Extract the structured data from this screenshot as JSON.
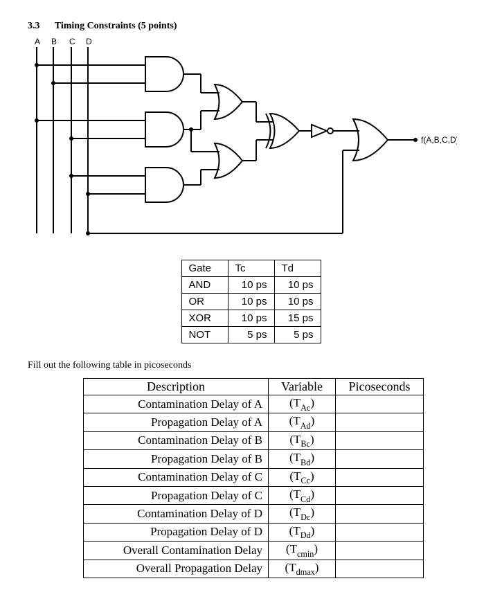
{
  "heading": {
    "section_number": "3.3",
    "title": "Timing Constraints (5 points)"
  },
  "inputs": [
    "A",
    "B",
    "C",
    "D"
  ],
  "output_label": "f(A,B,C,D)",
  "gate_timing": {
    "headers": [
      "Gate",
      "Tc",
      "Td"
    ],
    "rows": [
      {
        "gate": "AND",
        "tc": "10 ps",
        "td": "10 ps"
      },
      {
        "gate": "OR",
        "tc": "10 ps",
        "td": "10 ps"
      },
      {
        "gate": "XOR",
        "tc": "10 ps",
        "td": "15 ps"
      },
      {
        "gate": "NOT",
        "tc": "5 ps",
        "td": "5 ps"
      }
    ]
  },
  "instruction": "Fill out the following table in picoseconds",
  "answer_table": {
    "headers": [
      "Description",
      "Variable",
      "Picoseconds"
    ],
    "rows": [
      {
        "desc": "Contamination Delay of A",
        "var_base": "T",
        "var_sub": "Ac",
        "ps": ""
      },
      {
        "desc": "Propagation Delay of A",
        "var_base": "T",
        "var_sub": "Ad",
        "ps": ""
      },
      {
        "desc": "Contamination Delay of B",
        "var_base": "T",
        "var_sub": "Bc",
        "ps": ""
      },
      {
        "desc": "Propagation Delay of B",
        "var_base": "T",
        "var_sub": "Bd",
        "ps": ""
      },
      {
        "desc": "Contamination Delay of C",
        "var_base": "T",
        "var_sub": "Cc",
        "ps": ""
      },
      {
        "desc": "Propagation Delay of C",
        "var_base": "T",
        "var_sub": "Cd",
        "ps": ""
      },
      {
        "desc": "Contamination Delay of D",
        "var_base": "T",
        "var_sub": "Dc",
        "ps": ""
      },
      {
        "desc": "Propagation Delay of D",
        "var_base": "T",
        "var_sub": "Dd",
        "ps": ""
      },
      {
        "desc": "Overall Contamination Delay",
        "var_base": "T",
        "var_sub": "cmin",
        "ps": ""
      },
      {
        "desc": "Overall Propagation Delay",
        "var_base": "T",
        "var_sub": "dmax",
        "ps": ""
      }
    ]
  }
}
